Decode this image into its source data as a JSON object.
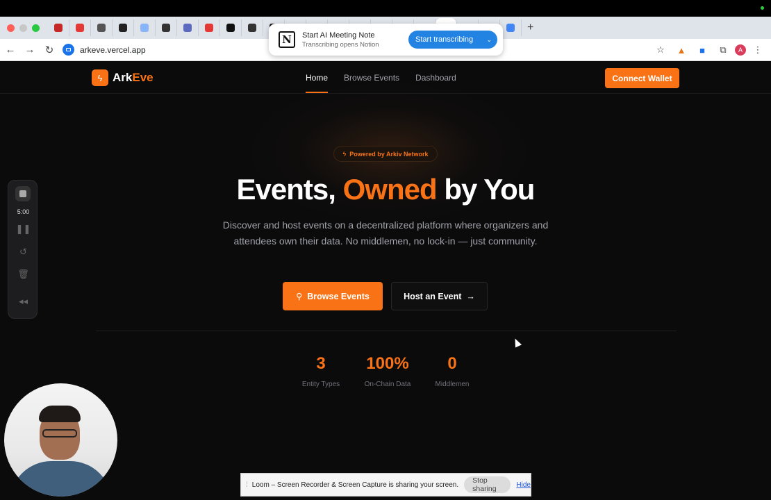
{
  "browser": {
    "url": "arkeve.vercel.app",
    "tab_favicon_colors": [
      "#c62828",
      "#e53935",
      "#555555",
      "#222222",
      "#8ab4f8",
      "#333333",
      "#5c6bc0",
      "#e53935",
      "#111111",
      "#333333",
      "#111111",
      "#555555",
      "#4285f4",
      "#4285f4",
      "#111111",
      "#c62828",
      "#1a237e",
      "#111111"
    ],
    "new_tab_symbol": "+",
    "avatar_letter": "A"
  },
  "notion_popup": {
    "logo": "N",
    "title": "Start AI Meeting Note",
    "subtitle": "Transcribing opens Notion",
    "button_label": "Start transcribing"
  },
  "site": {
    "brand_first": "Ark",
    "brand_second": "Eve",
    "nav": [
      {
        "label": "Home",
        "active": true
      },
      {
        "label": "Browse Events",
        "active": false
      },
      {
        "label": "Dashboard",
        "active": false
      }
    ],
    "connect_wallet": "Connect Wallet",
    "badge": "Powered by Arkiv Network",
    "hero_title_1": "Events,",
    "hero_title_accent": "Owned",
    "hero_title_2": "by You",
    "hero_subtitle": "Discover and host events on a decentralized platform where organizers and attendees own their data. No middlemen, no lock-in — just community.",
    "primary_cta": "Browse Events",
    "secondary_cta": "Host an Event",
    "stats": [
      {
        "value": "3",
        "label": "Entity Types"
      },
      {
        "value": "100%",
        "label": "On-Chain Data"
      },
      {
        "value": "0",
        "label": "Middlemen"
      }
    ],
    "accent_color": "#f97316"
  },
  "loom": {
    "timer": "5:00",
    "share_message": "Loom – Screen Recorder & Screen Capture is sharing your screen.",
    "stop_sharing": "Stop sharing",
    "hide": "Hide"
  }
}
